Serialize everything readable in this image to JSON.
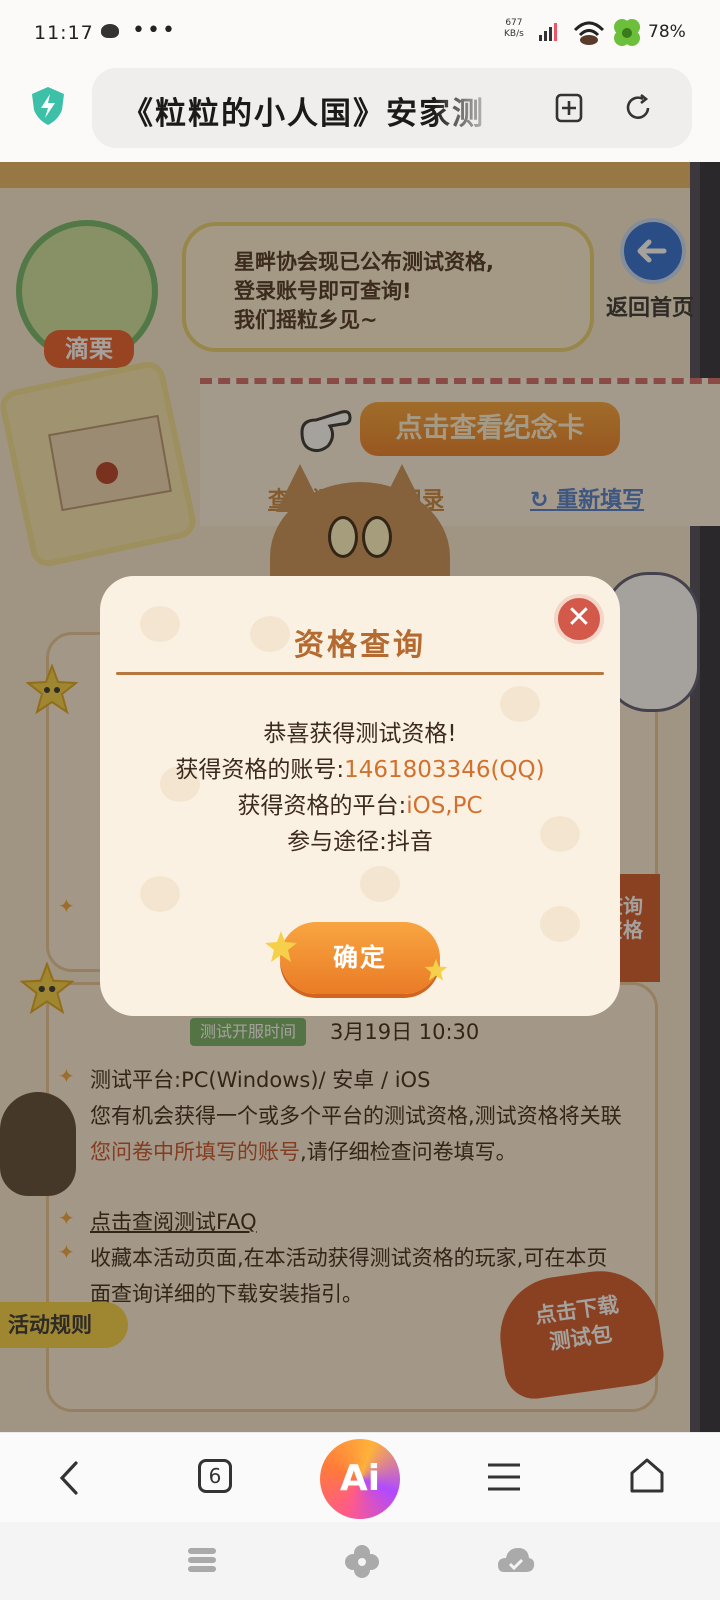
{
  "status_bar": {
    "time": "11:17",
    "dots": "•••",
    "net_speed_value": "677",
    "net_speed_unit": "KB/s",
    "battery": "78%"
  },
  "browser": {
    "url_title": "《粒粒的小人国》安家测",
    "icons": [
      "shield-icon",
      "bookmark-add-icon",
      "refresh-icon"
    ]
  },
  "page": {
    "speech_lines": [
      "星畔协会现已公布测试资格,",
      "登录账号即可查询!",
      "我们摇粒乡见~"
    ],
    "avatar_name": "滴栗",
    "back_home": "返回首页",
    "memorial_button": "点击查看纪念卡",
    "record_link": "查看问卷填写记录",
    "refill_link": "重新填写",
    "side_query_button": "查询\n资格",
    "test_time_badge": "测试开服时间",
    "test_time_value": "3月19日  10:30",
    "platform_row": "测试平台:PC(Windows)/ 安卓 / iOS",
    "desc_part1": "您有机会获得一个或多个平台的测试资格,测试资格将关联",
    "desc_highlight": "您问卷中所填写的账号",
    "desc_part2": ",请仔细检查问卷填写。",
    "faq_link": "点击查阅测试FAQ",
    "save_row": "收藏本活动页面,在本活动获得测试资格的玩家,可在本页面查询详细的下载安装指引。",
    "rule_tag": "活动规则",
    "download_button": "点击下载\n测试包",
    "accent_orange": "#ea7b26",
    "accent_red": "#d05a2c"
  },
  "modal": {
    "title": "资格查询",
    "line1": "恭喜获得测试资格!",
    "account_label": "获得资格的账号:",
    "account_value": "1461803346(QQ)",
    "platform_label": "获得资格的平台:",
    "platform_value": "iOS,PC",
    "route_label": "参与途径:",
    "route_value": "抖音",
    "close_symbol": "✕",
    "confirm": "确定"
  },
  "bottom_nav": {
    "tab_count": "6",
    "ai_label": "Ai"
  }
}
